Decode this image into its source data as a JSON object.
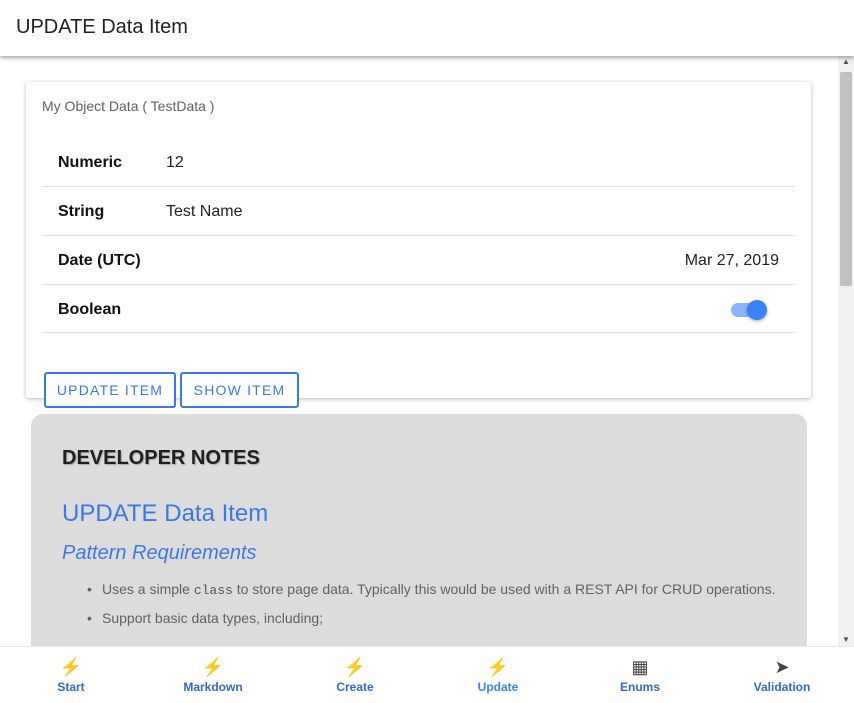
{
  "app": {
    "title": "UPDATE Data Item"
  },
  "card": {
    "title": "My Object Data ( TestData )",
    "rows": [
      {
        "label": "Numeric",
        "value": "12"
      },
      {
        "label": "String",
        "value": "Test Name"
      },
      {
        "label": "Date (UTC)",
        "value": "Mar 27, 2019"
      },
      {
        "label": "Boolean",
        "value": true
      }
    ],
    "buttons": {
      "update": "UPDATE ITEM",
      "show": "SHOW ITEM"
    }
  },
  "notes": {
    "heading": "DEVELOPER NOTES",
    "title": "UPDATE Data Item",
    "subtitle": "Pattern Requirements",
    "bullets": {
      "b1_pre": "Uses a simple ",
      "b1_code": "class",
      "b1_post": " to store page data. Typically this would be used with a REST API for CRUD operations.",
      "b2": "Support basic data types, including;"
    }
  },
  "bottom_nav": [
    {
      "label": "Start",
      "icon": "bolt-icon",
      "glyph": "⚡",
      "active": false
    },
    {
      "label": "Markdown",
      "icon": "bolt-icon",
      "glyph": "⚡",
      "active": false
    },
    {
      "label": "Create",
      "icon": "bolt-icon",
      "glyph": "⚡",
      "active": false
    },
    {
      "label": "Update",
      "icon": "bolt-icon",
      "glyph": "⚡",
      "active": true
    },
    {
      "label": "Enums",
      "icon": "grid-icon",
      "glyph": "▦",
      "active": false
    },
    {
      "label": "Validation",
      "icon": "send-icon",
      "glyph": "➤",
      "active": false
    }
  ],
  "colors": {
    "accent": "#3b78e7",
    "active_nav": "#3b82f6",
    "notes_bg": "#dcdcdc"
  }
}
